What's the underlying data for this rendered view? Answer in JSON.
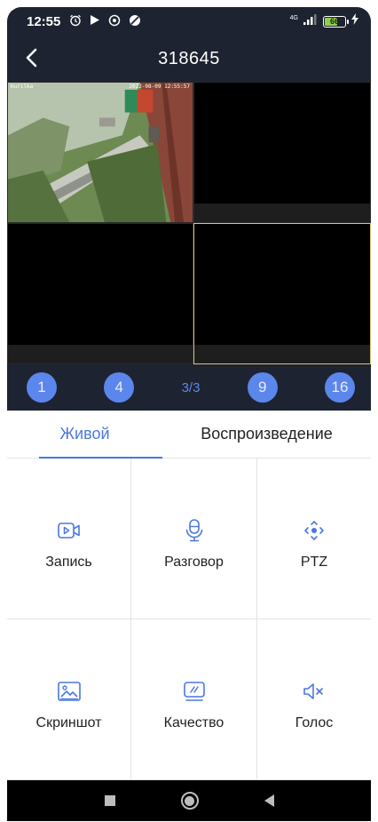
{
  "status_bar": {
    "time": "12:55",
    "network": "4G",
    "battery_level": "66",
    "battery_fraction": 0.66
  },
  "header": {
    "title": "318645"
  },
  "video": {
    "camera_1": {
      "osd_name": "Kurilka",
      "osd_timestamp": "2022-08-09 12:55:57"
    }
  },
  "layout_bar": {
    "buttons": [
      "1",
      "4",
      "9",
      "16"
    ],
    "page_indicator": "3/3"
  },
  "tabs": {
    "live": "Живой",
    "playback": "Воспроизведение"
  },
  "functions": {
    "record": "Запись",
    "talk": "Разговор",
    "ptz": "PTZ",
    "screenshot": "Скриншот",
    "quality": "Качество",
    "voice": "Голос"
  },
  "colors": {
    "header_bg": "#1d2330",
    "accent": "#4a78de",
    "layout_button": "#5b86ec",
    "battery": "#8bd34a",
    "selected_cell_border": "#d9c37a"
  }
}
